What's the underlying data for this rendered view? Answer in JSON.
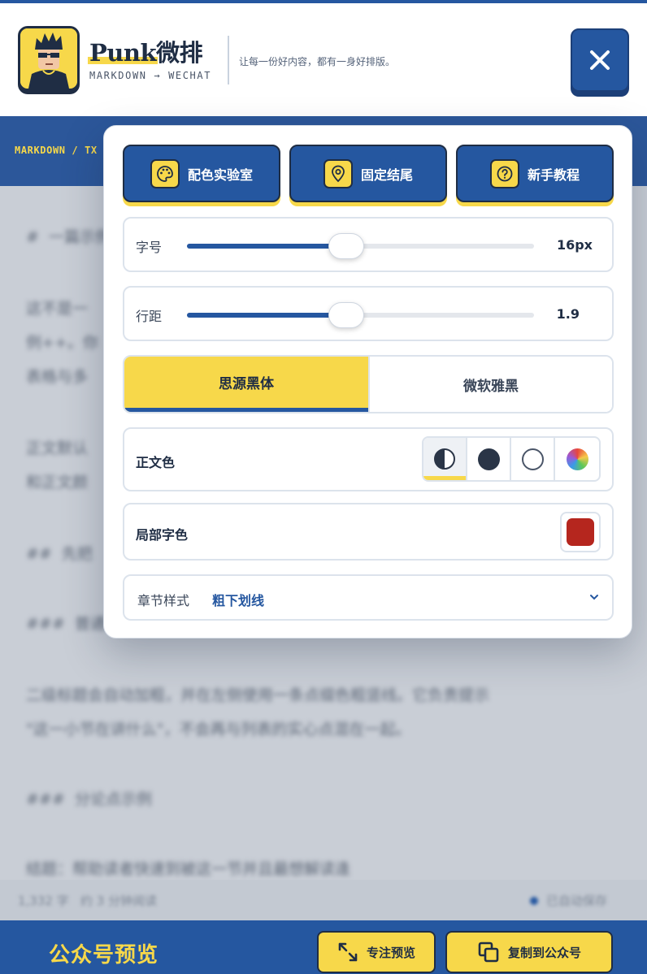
{
  "header": {
    "brand_name": "Punk微排",
    "brand_sub": "MARKDOWN → WECHAT",
    "slogan": "让每一份好内容，都有一身好排版。",
    "close_icon": "close-icon"
  },
  "breadcrumb": {
    "text": "MARKDOWN / TX"
  },
  "toolbar": {
    "color_lab_label": "配色实验室",
    "color_lab_icon": "palette-icon",
    "fixed_footer_label": "固定结尾",
    "fixed_footer_icon": "location-pin-icon",
    "tutorial_label": "新手教程",
    "tutorial_icon": "help-circle-icon"
  },
  "font_size": {
    "label": "字号",
    "value_text": "16px",
    "slider_fraction": 0.46
  },
  "line_height": {
    "label": "行距",
    "value_text": "1.9",
    "slider_fraction": 0.46
  },
  "font_family": {
    "options": [
      {
        "label": "思源黑体",
        "selected": true
      },
      {
        "label": "微软雅黑",
        "selected": false
      }
    ]
  },
  "body_color": {
    "label": "正文色",
    "swatches": [
      {
        "name": "auto-contrast",
        "color": "#2a3547",
        "selected": true
      },
      {
        "name": "dark",
        "color": "#2a3547",
        "selected": false
      },
      {
        "name": "white",
        "color": "#ffffff",
        "selected": false
      },
      {
        "name": "rainbow",
        "color": "rainbow",
        "selected": false
      }
    ]
  },
  "local_color": {
    "label": "局部字色",
    "color": "#b5261e"
  },
  "section_style": {
    "label": "章节样式",
    "value": "粗下划线",
    "caret_icon": "chevron-down-icon"
  },
  "bottom": {
    "title": "公众号预览",
    "focus_label": "专注预览",
    "focus_icon": "expand-icon",
    "copy_label": "复制到公众号",
    "copy_icon": "copy-icon"
  },
  "colors": {
    "primary_blue": "#2557a0",
    "accent_yellow": "#f7d84a",
    "ink": "#1f2d44"
  }
}
